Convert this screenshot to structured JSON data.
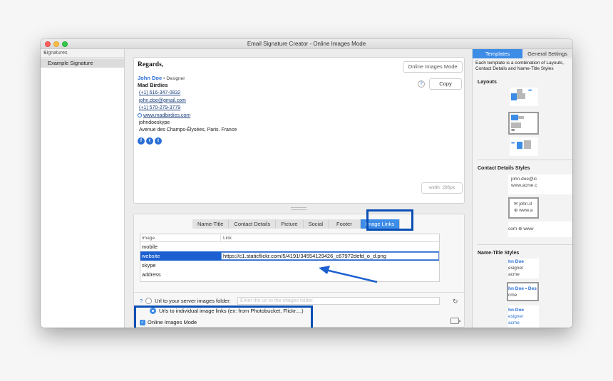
{
  "window": {
    "title": "Email Signature Creator - Online Images Mode"
  },
  "sidebar": {
    "header": "Signatures",
    "add_icon": "plus-icon",
    "items": [
      {
        "label": "Example Signature"
      }
    ]
  },
  "preview": {
    "greeting": "Regards,",
    "name": "John Doe",
    "separator": "•",
    "role": "Designer",
    "company": "Mad Birdies",
    "phone1": "(+1) 616-347-0832",
    "email": "john.doe@gmail.com",
    "phone2": "(+1) 570-279-3779",
    "website": "www.madbirdies.com",
    "skype": "johndoeskype",
    "address": "Avenue des Champs-Élysées, Paris. France",
    "social_icons": [
      {
        "icon": "facebook-icon",
        "glyph": "f"
      },
      {
        "icon": "twitter-icon",
        "glyph": "t"
      },
      {
        "icon": "tumblr-icon",
        "glyph": "t"
      }
    ],
    "online_images_button": "Online Images Mode",
    "help_label": "?",
    "copy_button": "Copy",
    "width_badge": "width: 286px"
  },
  "editor": {
    "tabs": [
      {
        "label": "Name-Title"
      },
      {
        "label": "Contact Details"
      },
      {
        "label": "Picture"
      },
      {
        "label": "Social"
      },
      {
        "label": "Footer"
      },
      {
        "label": "Image Links",
        "active": true
      }
    ],
    "table": {
      "columns": [
        "Image",
        "Link"
      ],
      "rows": [
        {
          "image": "mobile",
          "link": ""
        },
        {
          "image": "website",
          "link": "https://c1.staticflickr.com/5/4191/34554129426_c67972defd_o_d.png",
          "selected": true
        },
        {
          "image": "skype",
          "link": ""
        },
        {
          "image": "address",
          "link": ""
        }
      ]
    },
    "options": {
      "help_label": "?",
      "server_folder_label": "Url to your server images folder:",
      "server_folder_placeholder": "Enter the url to the images folder.",
      "individual_links_label": "Urls to individual image links (ex: from Photobucket, Flickr....)",
      "individual_links_selected": true,
      "online_images_mode_label": "Online Images Mode",
      "online_images_mode_checked": true,
      "check_glyph": "✓",
      "refresh_glyph": "↻"
    }
  },
  "right_panel": {
    "tabs": [
      {
        "label": "Templates",
        "active": true
      },
      {
        "label": "General Settings"
      }
    ],
    "description": "Each template is a combination of Layouts, Contact Details and Name-Title Styles",
    "layouts_title": "Layouts",
    "contact_title": "Contact Details Styles",
    "contact_thumbs": [
      {
        "line1": "john.doe@ic",
        "line2": "www.acme.c"
      },
      {
        "line1": "✉ john.d",
        "line2": "⊕ www.a"
      },
      {
        "line1": "com ⊕ www"
      }
    ],
    "name_title": "Name-Title Styles",
    "name_thumbs": [
      {
        "line1": "hn Doe",
        "line2": "esigner",
        "line3": "acme"
      },
      {
        "line1": "hn Doe • Des",
        "line2": "cme"
      },
      {
        "line1": "hn Doe",
        "line2": "esigner",
        "line3": "acme"
      }
    ],
    "dots": "•••"
  },
  "colors": {
    "accent": "#3d8ce6",
    "highlight": "#0a4fb5",
    "selection": "#1b5fd0"
  }
}
